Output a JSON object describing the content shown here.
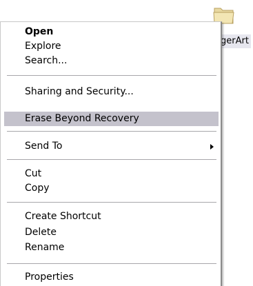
{
  "desktop": {
    "folder_label": "gerArt",
    "icon": "folder-icon"
  },
  "context_menu": {
    "items": [
      {
        "label": "Open",
        "bold": true
      },
      {
        "label": "Explore"
      },
      {
        "label": "Search..."
      },
      {
        "label": "Sharing and Security..."
      },
      {
        "label": "Erase Beyond Recovery",
        "highlighted": true
      },
      {
        "label": "Send To",
        "submenu": true
      },
      {
        "label": "Cut"
      },
      {
        "label": "Copy"
      },
      {
        "label": "Create Shortcut"
      },
      {
        "label": "Delete"
      },
      {
        "label": "Rename"
      },
      {
        "label": "Properties"
      }
    ],
    "submenu_icon": "chevron-right-icon",
    "highlight_color": "#c4c2cc"
  }
}
